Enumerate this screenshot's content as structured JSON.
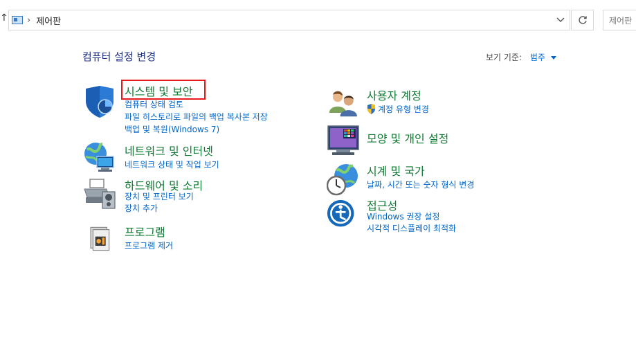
{
  "address_bar": {
    "path": "제어판",
    "search_placeholder": "제어판"
  },
  "main": {
    "heading": "컴퓨터 설정 변경",
    "view_by_label": "보기 기준:",
    "view_by_value": "범주"
  },
  "categories_left": [
    {
      "title": "시스템 및 보안",
      "links": [
        "컴퓨터 상태 검토",
        "파일 히스토리로 파일의 백업 복사본 저장",
        "백업 및 복원(Windows 7)"
      ],
      "icon": "shield-icon"
    },
    {
      "title": "네트워크 및 인터넷",
      "links": [
        "네트워크 상태 및 작업 보기"
      ],
      "icon": "network-icon"
    },
    {
      "title": "하드웨어 및 소리",
      "links": [
        "장치 및 프린터 보기",
        "장치 추가"
      ],
      "icon": "printer-icon"
    },
    {
      "title": "프로그램",
      "links": [
        "프로그램 제거"
      ],
      "icon": "programs-icon"
    }
  ],
  "categories_right": [
    {
      "title": "사용자 계정",
      "links": [
        "계정 유형 변경"
      ],
      "icon": "users-icon"
    },
    {
      "title": "모양 및 개인 설정",
      "links": [],
      "icon": "display-icon"
    },
    {
      "title": "시계 및 국가",
      "links": [
        "날짜, 시간 또는 숫자 형식 변경"
      ],
      "icon": "clock-globe-icon"
    },
    {
      "title": "접근성",
      "links": [
        "Windows 권장 설정",
        "시각적 디스플레이 최적화"
      ],
      "icon": "accessibility-icon"
    }
  ],
  "colors": {
    "category_title": "#0f7a32",
    "link": "#0066cc",
    "heading": "#1e3287",
    "highlight": "#e8191b"
  }
}
